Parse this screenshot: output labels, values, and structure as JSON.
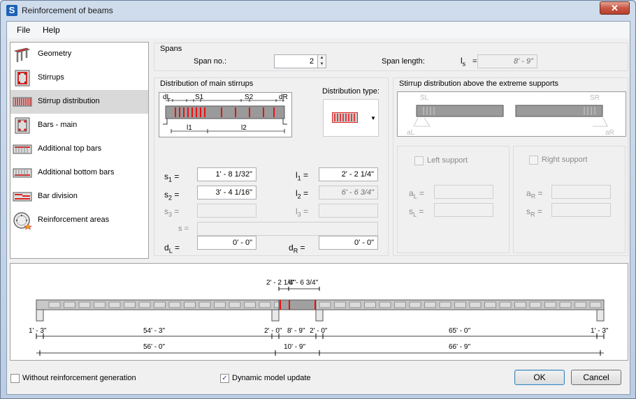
{
  "window": {
    "title": "Reinforcement of beams",
    "app_icon": "S",
    "close_glyph": "✕"
  },
  "menu": {
    "file": "File",
    "help": "Help"
  },
  "nav": {
    "items": [
      {
        "label": "Geometry",
        "icon": "geometry-icon"
      },
      {
        "label": "Stirrups",
        "icon": "stirrups-icon"
      },
      {
        "label": "Stirrup distribution",
        "icon": "stirrup-distribution-icon",
        "selected": true
      },
      {
        "label": "Bars - main",
        "icon": "bars-main-icon"
      },
      {
        "label": "Additional top bars",
        "icon": "additional-top-bars-icon"
      },
      {
        "label": "Additional bottom bars",
        "icon": "additional-bottom-bars-icon"
      },
      {
        "label": "Bar division",
        "icon": "bar-division-icon"
      },
      {
        "label": "Reinforcement areas",
        "icon": "reinforcement-areas-icon"
      }
    ]
  },
  "spans": {
    "title": "Spans",
    "span_no_label": "Span no.:",
    "span_no_value": "2",
    "span_length_label": "Span length:",
    "ls_label": "l",
    "ls_sub": "s",
    "ls_eq": "=",
    "span_length_value": "8' - 9\""
  },
  "main_stirrups": {
    "title": "Distribution of main stirrups",
    "diagram": {
      "dL": "dL",
      "dR": "dR",
      "s1": "S1",
      "s2": "S2",
      "l1": "l1",
      "l2": "l2"
    },
    "distribution_type_label": "Distribution type:",
    "s1_label": "s",
    "s1_sub": "1",
    "s1_value": "1' - 8 1/32\"",
    "l1_label": "l",
    "l1_sub": "1",
    "l1_value": "2' - 2 1/4\"",
    "s2_label": "s",
    "s2_sub": "2",
    "s2_value": "3' - 4 1/16\"",
    "l2_label": "l",
    "l2_sub": "2",
    "l2_value": "6' - 6 3/4\"",
    "s3_label": "s",
    "s3_sub": "3",
    "s3_value": "",
    "l3_label": "l",
    "l3_sub": "3",
    "l3_value": "",
    "s_label": "s",
    "s_value": "",
    "dL_label": "d",
    "dL_sub": "L",
    "dL_value": "0' - 0\"",
    "dR_label": "d",
    "dR_sub": "R",
    "dR_value": "0' - 0\"",
    "eq": "="
  },
  "extreme_supports": {
    "title": "Stirrup distribution above the extreme supports",
    "diagram": {
      "sL": "SL",
      "sR": "SR",
      "aL": "aL",
      "aR": "aR"
    },
    "left_support": "Left support",
    "right_support": "Right support",
    "aL_label": "a",
    "aL_sub": "L",
    "aL_value": "",
    "sL_label": "s",
    "sL_sub": "L",
    "sL_value": "",
    "aR_label": "a",
    "aR_sub": "R",
    "aR_value": "",
    "sR_label": "s",
    "sR_sub": "R",
    "sR_value": ""
  },
  "beam_drawing": {
    "top_dims": [
      "2' - 2 1/4\"",
      "6' - 6 3/4\""
    ],
    "row1": [
      "1' - 3\"",
      "54' - 3\"",
      "2' - 0\"",
      "8' - 9\"",
      "2' - 0\"",
      "65' - 0\"",
      "1' - 3\""
    ],
    "row2": [
      "56' - 0\"",
      "10' - 9\"",
      "66' - 9\""
    ]
  },
  "footer": {
    "without_generation": "Without reinforcement generation",
    "without_generation_checked": false,
    "dynamic_update": "Dynamic model update",
    "dynamic_update_checked": true,
    "check_glyph": "✓",
    "ok": "OK",
    "cancel": "Cancel"
  },
  "colors": {
    "rebar_red": "#e81010",
    "beam_gray": "#9a9a9a",
    "selection_gray": "#d9d9d9"
  }
}
